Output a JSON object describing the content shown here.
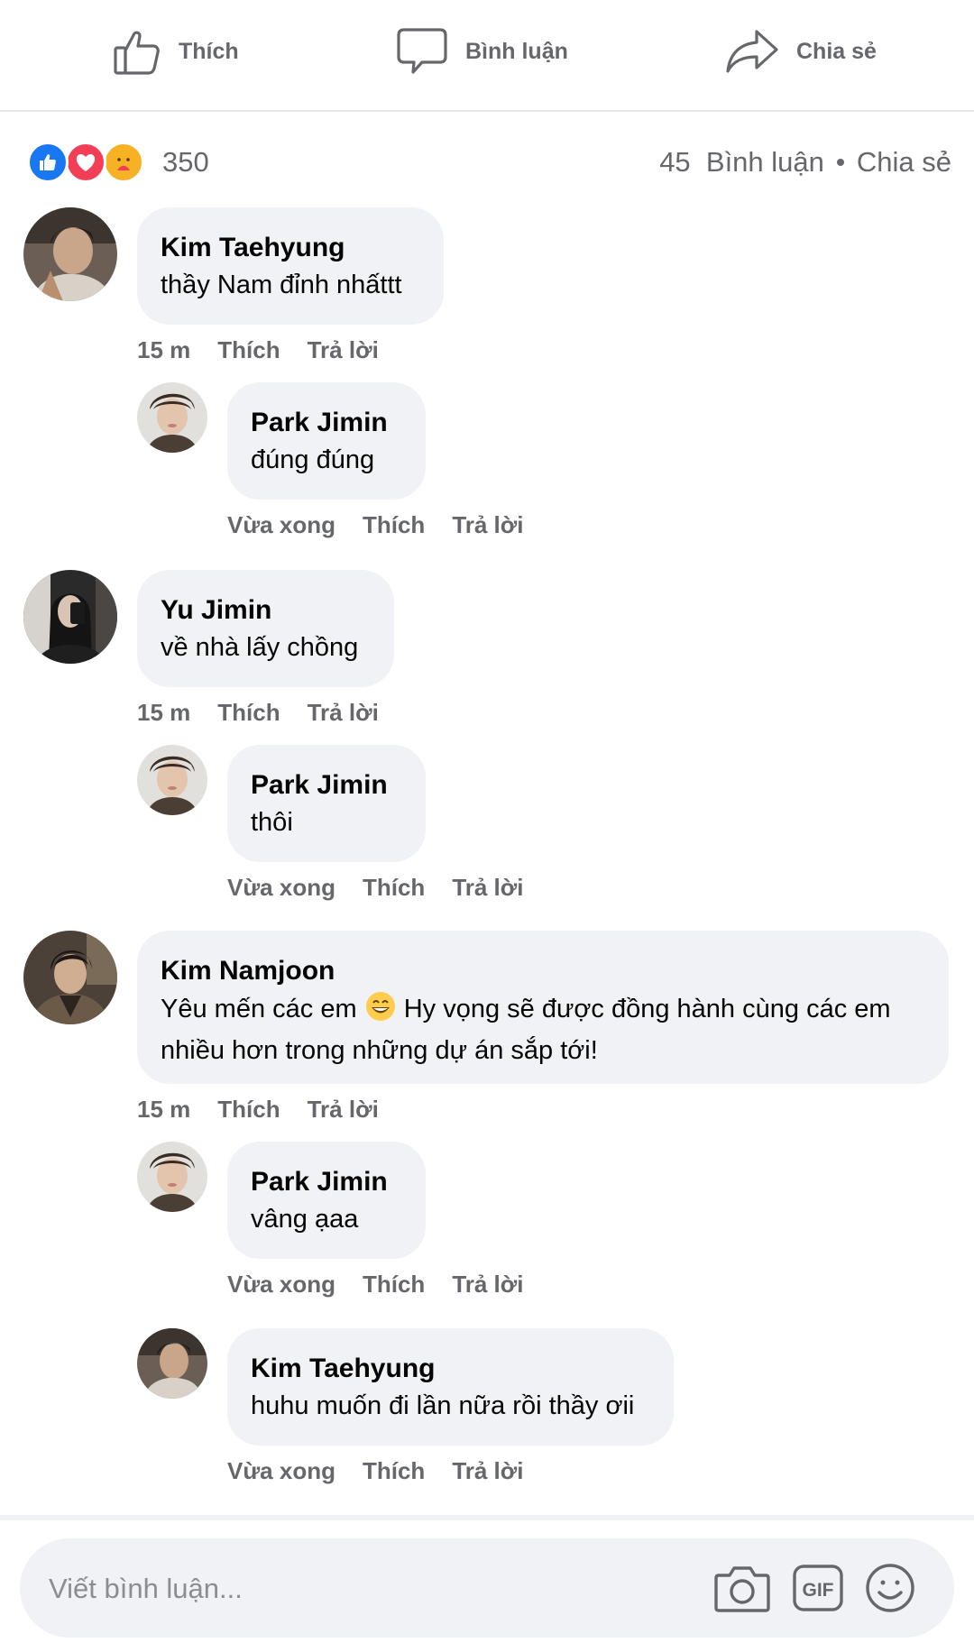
{
  "actions": {
    "like": "Thích",
    "comment": "Bình luận",
    "share": "Chia sẻ"
  },
  "summary": {
    "reaction_count": "350",
    "comments_label": "45  Bình luận",
    "share_label": "Chia sẻ",
    "reaction_types": [
      "like",
      "love",
      "care"
    ]
  },
  "comments": [
    {
      "author": "Kim Taehyung",
      "text": "thầy Nam đỉnh nhấttt",
      "time": "15 m",
      "like": "Thích",
      "reply": "Trả lời",
      "replies": [
        {
          "author": "Park Jimin",
          "text": "đúng đúng",
          "time": "Vừa xong",
          "like": "Thích",
          "reply": "Trả lời"
        }
      ]
    },
    {
      "author": "Yu Jimin",
      "text": "về nhà lấy chồng",
      "time": "15 m",
      "like": "Thích",
      "reply": "Trả lời",
      "replies": [
        {
          "author": "Park Jimin",
          "text": "thôi",
          "time": "Vừa xong",
          "like": "Thích",
          "reply": "Trả lời"
        }
      ]
    },
    {
      "author": "Kim Namjoon",
      "text_line1_a": "Yêu mến các em",
      "text_line1_b": "Hy vọng sẽ được đồng hành cùng các em",
      "text_line2": "nhiều hơn trong những dự án sắp tới!",
      "time": "15 m",
      "like": "Thích",
      "reply": "Trả lời",
      "replies": [
        {
          "author": "Park Jimin",
          "text": "vâng ạaa",
          "time": "Vừa xong",
          "like": "Thích",
          "reply": "Trả lời"
        },
        {
          "author": "Kim Taehyung",
          "text": "huhu muốn đi lần nữa rồi thầy ơii",
          "time": "Vừa xong",
          "like": "Thích",
          "reply": "Trả lời"
        }
      ]
    }
  ],
  "composer": {
    "placeholder": "Viết bình luận...",
    "icons": [
      "camera-icon",
      "gif-icon",
      "emoji-icon"
    ]
  }
}
